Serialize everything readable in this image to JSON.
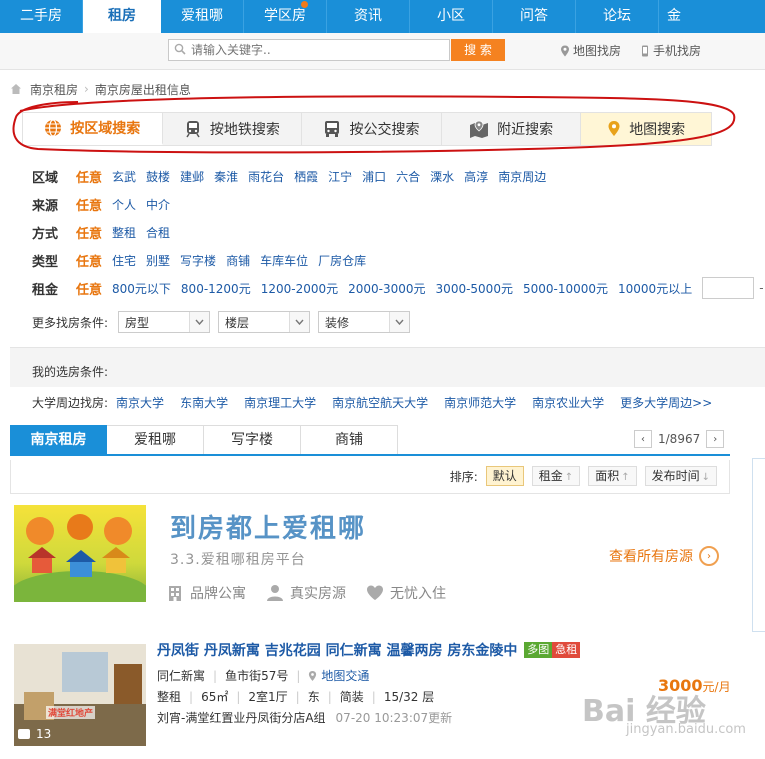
{
  "nav": {
    "items": [
      "二手房",
      "租房",
      "爱租哪",
      "学区房",
      "资讯",
      "小区",
      "问答",
      "论坛",
      "金"
    ],
    "active_index": 1
  },
  "search": {
    "placeholder": "请输入关键字..",
    "button": "搜 索",
    "map_link": "地图找房",
    "mobile_link": "手机找房"
  },
  "breadcrumb": [
    "南京租房",
    "南京房屋出租信息"
  ],
  "modes": [
    {
      "label": "按区域搜索",
      "icon": "globe-icon"
    },
    {
      "label": "按地铁搜索",
      "icon": "subway-icon"
    },
    {
      "label": "按公交搜索",
      "icon": "bus-icon"
    },
    {
      "label": "附近搜索",
      "icon": "nearby-map-icon"
    },
    {
      "label": "地图搜索",
      "icon": "map-pin-icon"
    }
  ],
  "filters": [
    {
      "label": "区域",
      "any": "任意",
      "options": [
        "玄武",
        "鼓楼",
        "建邺",
        "秦淮",
        "雨花台",
        "栖霞",
        "江宁",
        "浦口",
        "六合",
        "溧水",
        "高淳",
        "南京周边"
      ]
    },
    {
      "label": "来源",
      "any": "任意",
      "options": [
        "个人",
        "中介"
      ]
    },
    {
      "label": "方式",
      "any": "任意",
      "options": [
        "整租",
        "合租"
      ]
    },
    {
      "label": "类型",
      "any": "任意",
      "options": [
        "住宅",
        "别墅",
        "写字楼",
        "商铺",
        "车库车位",
        "厂房仓库"
      ]
    },
    {
      "label": "租金",
      "any": "任意",
      "options": [
        "800元以下",
        "800-1200元",
        "1200-2000元",
        "2000-3000元",
        "3000-5000元",
        "5000-10000元",
        "10000元以上"
      ]
    }
  ],
  "price_range_dash": "-",
  "more": {
    "label": "更多找房条件:",
    "selects": [
      "房型",
      "楼层",
      "装修"
    ]
  },
  "my_conditions": "我的选房条件:",
  "universities": {
    "label": "大学周边找房:",
    "items": [
      "南京大学",
      "东南大学",
      "南京理工大学",
      "南京航空航天大学",
      "南京师范大学",
      "南京农业大学",
      "更多大学周边>>"
    ]
  },
  "result_tabs": [
    "南京租房",
    "爱租哪",
    "写字楼",
    "商铺"
  ],
  "pager": {
    "prev": "‹",
    "text": "1/8967",
    "next": "›"
  },
  "sort": {
    "label": "排序:",
    "options": [
      "默认",
      "租金",
      "面积",
      "发布时间"
    ]
  },
  "promo": {
    "title": "到房都上爱租哪",
    "subtitle": "3.3.爱租哪租房平台",
    "tags": [
      "品牌公寓",
      "真实房源",
      "无忧入住"
    ],
    "link": "查看所有房源"
  },
  "listing": {
    "title": "丹凤街 丹凤新寓 吉兆花园 同仁新寓 温馨两房 房东金陵中",
    "badge_multi": "多图",
    "badge_urgent": "急租",
    "community": "同仁新寓",
    "street": "鱼市街57号",
    "map_link": "地图交通",
    "details": [
      "整租",
      "65㎡",
      "2室1厅",
      "东",
      "简装",
      "15/32 层"
    ],
    "agent": "刘宵-满堂红置业丹凤街分店A组",
    "time": "07-20 10:23:07更新",
    "price": "3000",
    "price_unit": "元/月",
    "photo_count": "13",
    "photo_label": "满堂红地产"
  },
  "watermark": {
    "main": "Bai 经验",
    "sub": "jingyan.baidu.com"
  },
  "colors": {
    "nav_blue": "#1a8fd8",
    "accent_orange": "#e8760f",
    "link_blue": "#1d5aa6",
    "annotation_red": "#cc1111"
  }
}
